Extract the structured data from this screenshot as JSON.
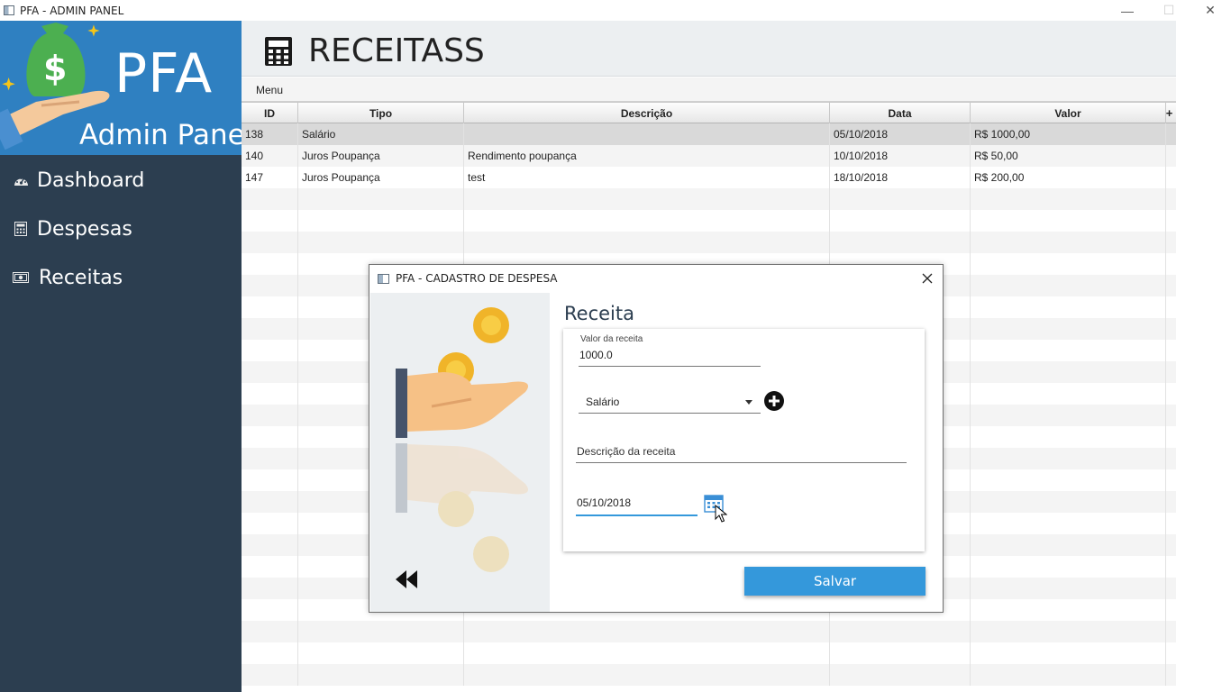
{
  "window": {
    "title": "PFA - ADMIN PANEL",
    "controls": {
      "minimize": "—",
      "maximize": "☐",
      "close": "✕"
    }
  },
  "sidebar": {
    "brand_title": "PFA",
    "brand_subtitle": "Admin Panel",
    "items": [
      {
        "label": "Dashboard",
        "icon": "dashboard-gauge-icon"
      },
      {
        "label": "Despesas",
        "icon": "calculator-icon"
      },
      {
        "label": "Receitas",
        "icon": "money-bill-icon"
      }
    ]
  },
  "header": {
    "title": "RECEITASS",
    "icon": "calculator-icon"
  },
  "menubar": {
    "menu_label": "Menu"
  },
  "table": {
    "columns": [
      "ID",
      "Tipo",
      "Descrição",
      "Data",
      "Valor"
    ],
    "add_column": "+",
    "rows": [
      {
        "id": "138",
        "tipo": "Salário",
        "descricao": "",
        "data": "05/10/2018",
        "valor": "R$ 1000,00"
      },
      {
        "id": "140",
        "tipo": "Juros Poupança",
        "descricao": "Rendimento poupança",
        "data": "10/10/2018",
        "valor": "R$ 50,00"
      },
      {
        "id": "147",
        "tipo": "Juros Poupança",
        "descricao": "test",
        "data": "18/10/2018",
        "valor": "R$ 200,00"
      }
    ],
    "selected_row": 0
  },
  "dialog": {
    "title": "PFA - CADASTRO DE DESPESA",
    "form_title": "Receita",
    "valor_label": "Valor da receita",
    "valor_value": "1000.0",
    "tipo_value": "Salário",
    "descricao_placeholder": "Descrição da receita",
    "date_value": "05/10/2018",
    "save_label": "Salvar",
    "back_icon": "rewind-back-icon",
    "add_icon": "plus-circle-icon",
    "calendar_icon": "calendar-icon"
  },
  "colors": {
    "sidebar_bg": "#2c3e50",
    "brand_bg": "#2f80c1",
    "accent": "#3498db",
    "selected_row": "#d9d9d9"
  }
}
